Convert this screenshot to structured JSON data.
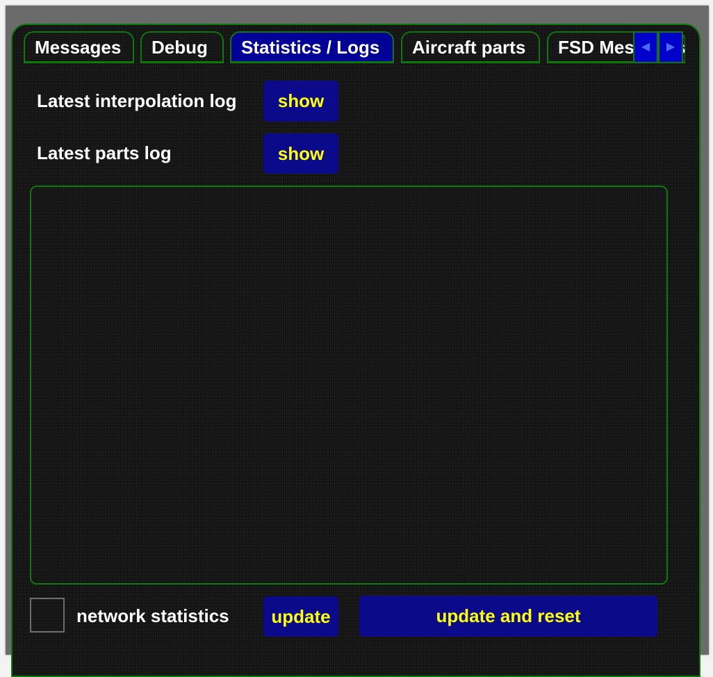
{
  "tabs": [
    {
      "label": "Messages",
      "active": false
    },
    {
      "label": "Debug",
      "active": false
    },
    {
      "label": "Statistics / Logs",
      "active": true
    },
    {
      "label": "Aircraft parts",
      "active": false
    },
    {
      "label": "FSD Messages",
      "active": false
    }
  ],
  "tab_scroll": {
    "left_icon": "arrow-left-icon",
    "right_icon": "arrow-right-icon"
  },
  "logs": {
    "interpolation_label": "Latest interpolation log",
    "interpolation_button": "show",
    "parts_label": "Latest parts log",
    "parts_button": "show",
    "output_text": ""
  },
  "statistics": {
    "checkbox_checked": false,
    "checkbox_label": "network statistics",
    "update_button": "update",
    "update_reset_button": "update and reset"
  },
  "colors": {
    "background": "#111111",
    "border_green": "#0a7a0a",
    "active_tab": "#000099",
    "button_bg": "#0a0a8a",
    "button_text": "#ffff00",
    "label_text": "#ffffff"
  }
}
